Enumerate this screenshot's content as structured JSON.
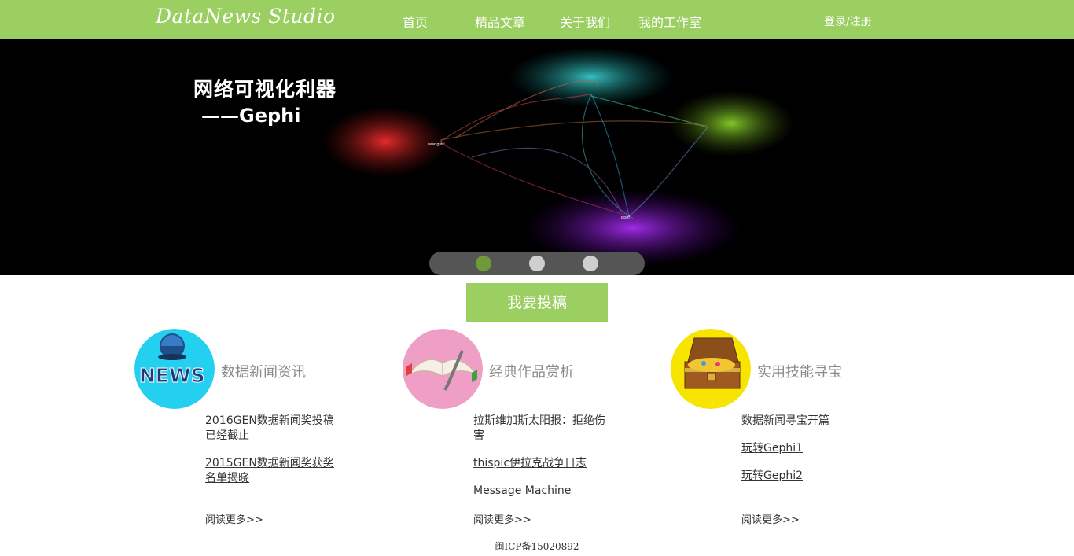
{
  "header": {
    "logo": "DataNews Studio",
    "nav": [
      "首页",
      "精品文章",
      "关于我们",
      "我的工作室"
    ],
    "login": "登录/注册"
  },
  "banner": {
    "title": "网络可视化利器",
    "subtitle": "——Gephi",
    "slides": 3,
    "active_slide": 1
  },
  "submit_button": "我要投稿",
  "sections": [
    {
      "icon": "news-globe-icon",
      "title": "数据新闻资讯",
      "links": [
        "2016GEN数据新闻奖投稿已经截止",
        "2015GEN数据新闻奖获奖名单揭晓"
      ],
      "more": "阅读更多>>"
    },
    {
      "icon": "open-book-pen-icon",
      "title": "经典作品赏析",
      "links": [
        "拉斯维加斯太阳报：拒绝伤害",
        "thispic伊拉克战争日志",
        "Message Machine"
      ],
      "more": "阅读更多>>"
    },
    {
      "icon": "treasure-chest-icon",
      "title": "实用技能寻宝",
      "links": [
        "数据新闻寻宝开篇",
        "玩转Gephi1",
        "玩转Gephi2"
      ],
      "more": "阅读更多>>"
    }
  ],
  "footer": "闽ICP备15020892",
  "colors": {
    "brand_green": "#9ccf62",
    "dot_active": "#6f9a3a"
  }
}
